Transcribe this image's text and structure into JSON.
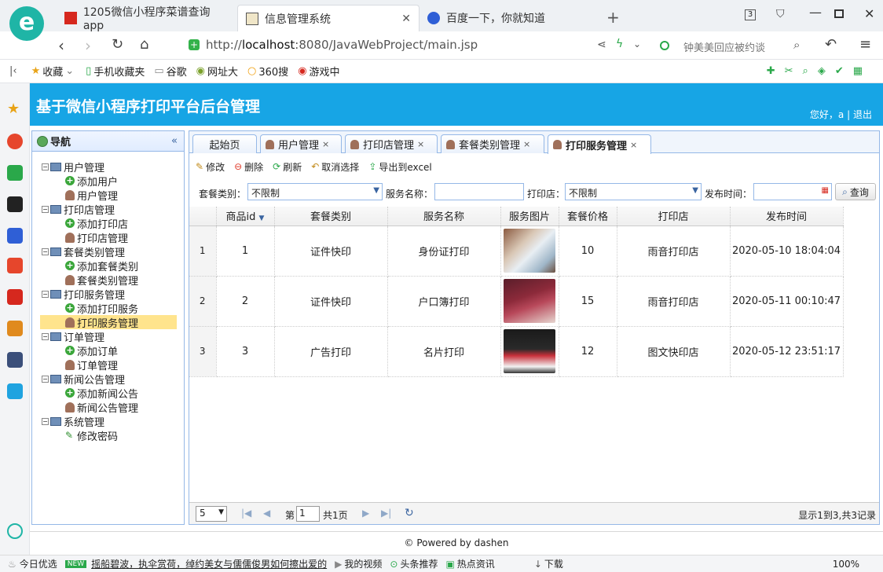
{
  "browser": {
    "tabs": [
      {
        "label": "1205微信小程序菜谱查询app"
      },
      {
        "label": "信息管理系统"
      },
      {
        "label": "百度一下，你就知道"
      }
    ],
    "tab_count": "3",
    "url_prefix": "http://",
    "url_host": "localhost",
    "url_rest": ":8080/JavaWebProject/main.jsp",
    "search_hint": "钟美美回应被约谈",
    "bookmarks": [
      "收藏",
      "手机收藏夹",
      "谷歌",
      "网址大",
      "360搜",
      "游戏中"
    ]
  },
  "app": {
    "title": "基于微信小程序打印平台后台管理",
    "greeting": "您好，a",
    "separator": "|",
    "logout": "退出"
  },
  "nav": {
    "title": "导航",
    "groups": [
      {
        "label": "用户管理",
        "items": [
          "添加用户",
          "用户管理"
        ]
      },
      {
        "label": "打印店管理",
        "items": [
          "添加打印店",
          "打印店管理"
        ]
      },
      {
        "label": "套餐类别管理",
        "items": [
          "添加套餐类别",
          "套餐类别管理"
        ]
      },
      {
        "label": "打印服务管理",
        "items": [
          "添加打印服务",
          "打印服务管理"
        ]
      },
      {
        "label": "订单管理",
        "items": [
          "添加订单",
          "订单管理"
        ]
      },
      {
        "label": "新闻公告管理",
        "items": [
          "添加新闻公告",
          "新闻公告管理"
        ]
      },
      {
        "label": "系统管理",
        "items": [
          "修改密码"
        ]
      }
    ]
  },
  "page_tabs": [
    "起始页",
    "用户管理",
    "打印店管理",
    "套餐类别管理",
    "打印服务管理"
  ],
  "toolbar": {
    "edit": "修改",
    "delete": "删除",
    "refresh": "刷新",
    "deselect": "取消选择",
    "export": "导出到excel"
  },
  "filters": {
    "category_label": "套餐类别：",
    "category_value": "不限制",
    "name_label": "服务名称：",
    "name_value": "",
    "shop_label": "打印店：",
    "shop_value": "不限制",
    "time_label": "发布时间：",
    "time_value": "",
    "search": "查询"
  },
  "table": {
    "columns": [
      "商品id",
      "套餐类别",
      "服务名称",
      "服务图片",
      "套餐价格",
      "打印店",
      "发布时间"
    ],
    "rows": [
      {
        "n": "1",
        "id": "1",
        "category": "证件快印",
        "name": "身份证打印",
        "price": "10",
        "shop": "雨音打印店",
        "time": "2020-05-10 18:04:04"
      },
      {
        "n": "2",
        "id": "2",
        "category": "证件快印",
        "name": "户口簿打印",
        "price": "15",
        "shop": "雨音打印店",
        "time": "2020-05-11 00:10:47"
      },
      {
        "n": "3",
        "id": "3",
        "category": "广告打印",
        "name": "名片打印",
        "price": "12",
        "shop": "图文快印店",
        "time": "2020-05-12 23:51:17"
      }
    ]
  },
  "pager": {
    "page_size": "5",
    "page_prefix": "第",
    "page_value": "1",
    "page_total": "共1页",
    "summary": "显示1到3,共3记录"
  },
  "footer": "© Powered by dashen",
  "statusbar": {
    "news": "今日优选",
    "badge": "NEW",
    "headline": "摇船碧波，执伞赏荷，绰约美女与儒儒俊男如何擦出爱的",
    "video": "我的视频",
    "toutiao": "头条推荐",
    "hot": "热点资讯",
    "download": "下载",
    "zoom": "100%"
  }
}
